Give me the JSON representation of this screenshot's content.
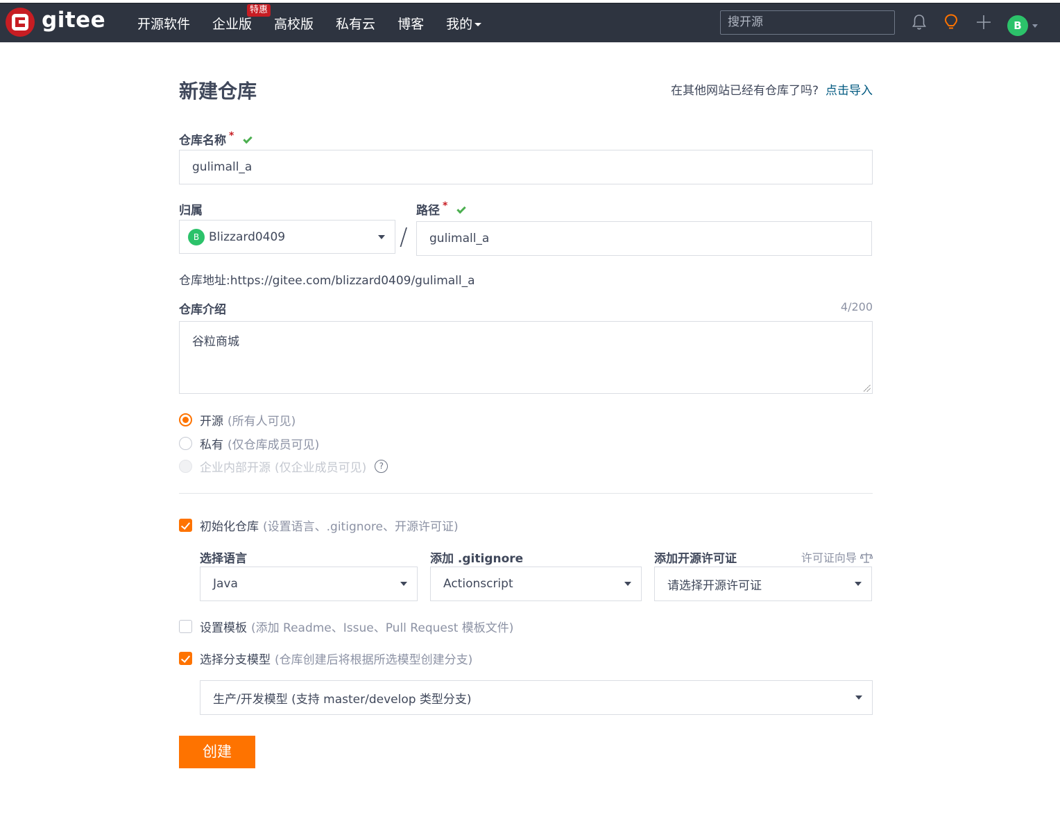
{
  "nav": {
    "logo_text": "gitee",
    "items": [
      {
        "label": "开源软件"
      },
      {
        "label": "企业版",
        "badge": "特惠"
      },
      {
        "label": "高校版"
      },
      {
        "label": "私有云"
      },
      {
        "label": "博客"
      },
      {
        "label": "我的"
      }
    ],
    "search_placeholder": "搜开源",
    "avatar_letter": "B"
  },
  "form": {
    "title": "新建仓库",
    "import_question": "在其他网站已经有仓库了吗?",
    "import_link": "点击导入",
    "repo_name_label": "仓库名称",
    "required_mark": "*",
    "repo_name_value": "gulimall_a",
    "owner_label": "归属",
    "owner_value": "Blizzard0409",
    "owner_avatar": "B",
    "path_label": "路径",
    "path_separator": "/",
    "path_value": "gulimall_a",
    "repo_url_label": "仓库地址:",
    "repo_url": "https://gitee.com/blizzard0409/gulimall_a",
    "intro_label": "仓库介绍",
    "intro_counter": "4/200",
    "intro_value": "谷粒商城",
    "visibility": [
      {
        "label": "开源",
        "hint": "(所有人可见)",
        "state": "selected"
      },
      {
        "label": "私有",
        "hint": "(仅仓库成员可见)",
        "state": "unselected"
      },
      {
        "label": "企业内部开源",
        "hint": "(仅企业成员可见)",
        "state": "disabled"
      }
    ],
    "init_repo": {
      "label": "初始化仓库",
      "hint": "(设置语言、.gitignore、开源许可证)",
      "checked": true
    },
    "language_label": "选择语言",
    "language_value": "Java",
    "gitignore_label": "添加 .gitignore",
    "gitignore_value": "Actionscript",
    "license_label": "添加开源许可证",
    "license_wizard": "许可证向导",
    "license_placeholder": "请选择开源许可证",
    "template": {
      "label": "设置模板",
      "hint": "(添加 Readme、Issue、Pull Request 模板文件)",
      "checked": false
    },
    "branch_model": {
      "label": "选择分支模型",
      "hint": "(仓库创建后将根据所选模型创建分支)",
      "checked": true
    },
    "branch_model_value": "生产/开发模型 (支持 master/develop 类型分支)",
    "submit_label": "创建"
  },
  "colors": {
    "accent": "#fe7300",
    "navbar": "#2e3440",
    "success": "#4caf50",
    "brand_red": "#c71d23",
    "link": "#005980"
  }
}
